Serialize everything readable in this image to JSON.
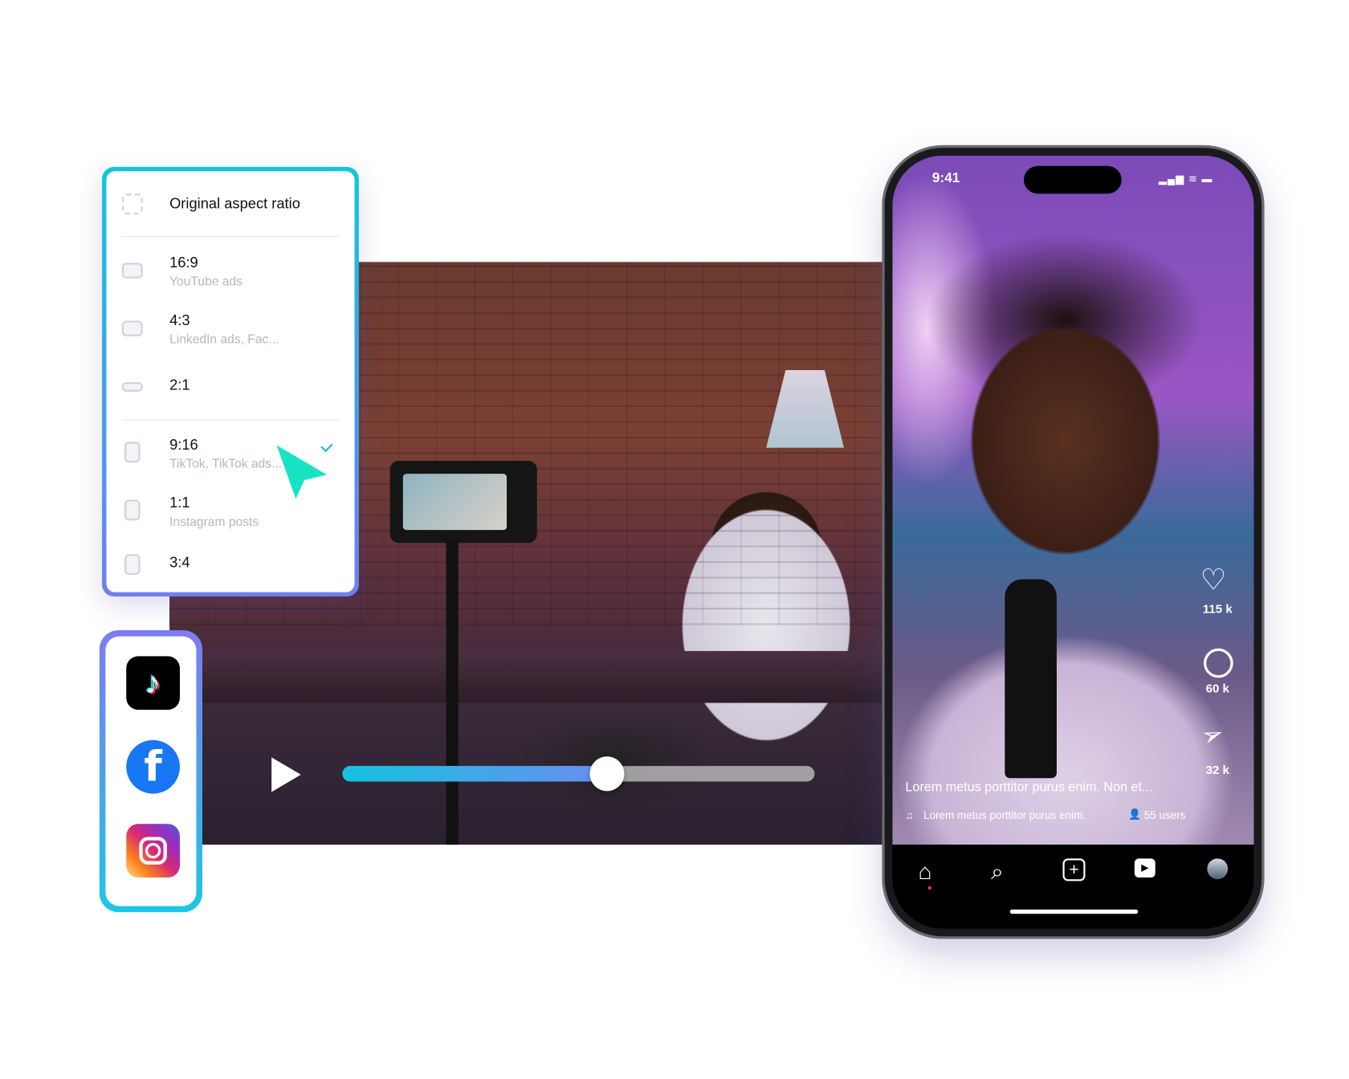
{
  "aspect_panel": {
    "original": {
      "label": "Original aspect ratio"
    },
    "options": [
      {
        "label": "16:9",
        "sub": "YouTube ads",
        "selected": false
      },
      {
        "label": "4:3",
        "sub": "LinkedIn ads, Fac...",
        "selected": false
      },
      {
        "label": "2:1",
        "sub": "",
        "selected": false
      },
      {
        "label": "9:16",
        "sub": "TikTok, TikTok ads...",
        "selected": true
      },
      {
        "label": "1:1",
        "sub": "Instagram posts",
        "selected": false
      },
      {
        "label": "3:4",
        "sub": "",
        "selected": false
      }
    ]
  },
  "player": {
    "progress_percent": 56,
    "accent_start": "#14c4e0",
    "accent_end": "#6a8cf0"
  },
  "social": [
    "tiktok-icon",
    "facebook-icon",
    "instagram-icon"
  ],
  "phone": {
    "time": "9:41",
    "likes": "115 k",
    "comments": "60 k",
    "shares": "32 k",
    "caption": "Lorem metus porttitor purus enim. Non et...",
    "music": "Lorem metus porttitor purus enim.",
    "users": "55 users",
    "nav": [
      "home-icon",
      "search-icon",
      "add-icon",
      "reels-icon",
      "profile-avatar"
    ]
  }
}
